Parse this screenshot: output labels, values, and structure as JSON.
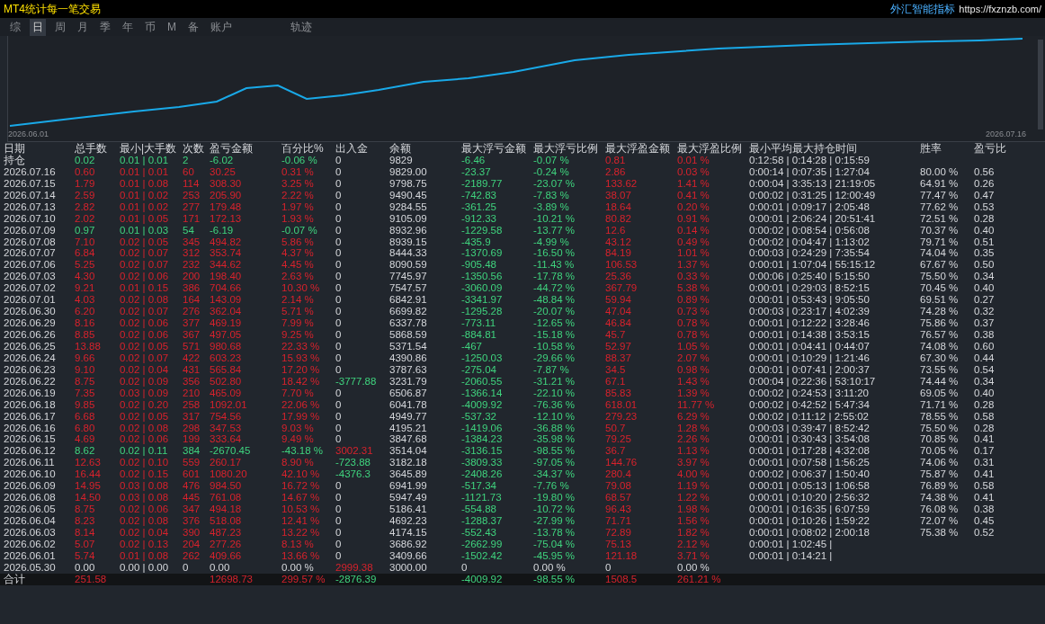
{
  "window": {
    "title": "MT4统计每一笔交易",
    "brand": "外汇智能指标",
    "link": "https://fxznzb.com/"
  },
  "tabs": [
    {
      "label": "综",
      "selected": false
    },
    {
      "label": "日",
      "selected": true
    },
    {
      "label": "周",
      "selected": false
    },
    {
      "label": "月",
      "selected": false
    },
    {
      "label": "季",
      "selected": false
    },
    {
      "label": "年",
      "selected": false
    },
    {
      "label": "币",
      "selected": false
    },
    {
      "label": "M",
      "selected": false
    },
    {
      "label": "备",
      "selected": false
    },
    {
      "label": "账户",
      "selected": false
    },
    {
      "label": "轨迹",
      "selected": false
    }
  ],
  "chart": {
    "start_label": "2026.06.01",
    "end_label": "2026.07.16"
  },
  "table": {
    "columns": [
      "日期",
      "总手数",
      "最小|大手数",
      "次数",
      "盈亏金额",
      "百分比%",
      "出入金",
      "余额",
      "最大浮亏金额",
      "最大浮亏比例",
      "最大浮盈金额",
      "最大浮盈比例",
      "最小平均最大持仓时间",
      "胜率",
      "盈亏比"
    ],
    "rows": [
      {
        "kind": "loss",
        "cells": [
          "持仓",
          "0.02",
          "0.01 | 0.01",
          "2",
          "-6.02",
          "-0.06 %",
          "0",
          "9829",
          "-6.46",
          "-0.07 %",
          "0.81",
          "0.01 %",
          "0:12:58 | 0:14:28 | 0:15:59"
        ]
      },
      {
        "kind": "gain",
        "cells": [
          "2026.07.16",
          "0.60",
          "0.01 | 0.01",
          "60",
          "30.25",
          "0.31 %",
          "0",
          "9829.00",
          "-23.37",
          "-0.24 %",
          "2.86",
          "0.03 %",
          "0:00:14 | 0:07:35 | 1:27:04",
          "80.00 %",
          "0.56"
        ]
      },
      {
        "kind": "gain",
        "cells": [
          "2026.07.15",
          "1.79",
          "0.01 | 0.08",
          "114",
          "308.30",
          "3.25 %",
          "0",
          "9798.75",
          "-2189.77",
          "-23.07 %",
          "133.62",
          "1.41 %",
          "0:00:04 | 3:35:13 | 21:19:05",
          "64.91 %",
          "0.26"
        ]
      },
      {
        "kind": "gain",
        "cells": [
          "2026.07.14",
          "2.59",
          "0.01 | 0.02",
          "253",
          "205.90",
          "2.22 %",
          "0",
          "9490.45",
          "-742.83",
          "-7.83 %",
          "38.07",
          "0.41 %",
          "0:00:02 | 0:31:25 | 12:00:49",
          "77.47 %",
          "0.47"
        ]
      },
      {
        "kind": "gain",
        "cells": [
          "2026.07.13",
          "2.82",
          "0.01 | 0.02",
          "277",
          "179.48",
          "1.97 %",
          "0",
          "9284.55",
          "-361.25",
          "-3.89 %",
          "18.64",
          "0.20 %",
          "0:00:01 | 0:09:17 | 2:05:48",
          "77.62 %",
          "0.53"
        ]
      },
      {
        "kind": "gain",
        "cells": [
          "2026.07.10",
          "2.02",
          "0.01 | 0.05",
          "171",
          "172.13",
          "1.93 %",
          "0",
          "9105.09",
          "-912.33",
          "-10.21 %",
          "80.82",
          "0.91 %",
          "0:00:01 | 2:06:24 | 20:51:41",
          "72.51 %",
          "0.28"
        ]
      },
      {
        "kind": "loss",
        "cells": [
          "2026.07.09",
          "0.97",
          "0.01 | 0.03",
          "54",
          "-6.19",
          "-0.07 %",
          "0",
          "8932.96",
          "-1229.58",
          "-13.77 %",
          "12.6",
          "0.14 %",
          "0:00:02 | 0:08:54 | 0:56:08",
          "70.37 %",
          "0.40"
        ]
      },
      {
        "kind": "gain",
        "cells": [
          "2026.07.08",
          "7.10",
          "0.02 | 0.05",
          "345",
          "494.82",
          "5.86 %",
          "0",
          "8939.15",
          "-435.9",
          "-4.99 %",
          "43.12",
          "0.49 %",
          "0:00:02 | 0:04:47 | 1:13:02",
          "79.71 %",
          "0.51"
        ]
      },
      {
        "kind": "gain",
        "cells": [
          "2026.07.07",
          "6.84",
          "0.02 | 0.07",
          "312",
          "353.74",
          "4.37 %",
          "0",
          "8444.33",
          "-1370.69",
          "-16.50 %",
          "84.19",
          "1.01 %",
          "0:00:03 | 0:24:29 | 7:35:54",
          "74.04 %",
          "0.35"
        ]
      },
      {
        "kind": "gain",
        "cells": [
          "2026.07.06",
          "5.25",
          "0.02 | 0.07",
          "232",
          "344.62",
          "4.45 %",
          "0",
          "8090.59",
          "-905.48",
          "-11.43 %",
          "106.53",
          "1.37 %",
          "0:00:01 | 1:07:04 | 55:15:12",
          "67.67 %",
          "0.50"
        ]
      },
      {
        "kind": "gain",
        "cells": [
          "2026.07.03",
          "4.30",
          "0.02 | 0.06",
          "200",
          "198.40",
          "2.63 %",
          "0",
          "7745.97",
          "-1350.56",
          "-17.78 %",
          "25.36",
          "0.33 %",
          "0:00:06 | 0:25:40 | 5:15:50",
          "75.50 %",
          "0.34"
        ]
      },
      {
        "kind": "gain",
        "cells": [
          "2026.07.02",
          "9.21",
          "0.01 | 0.15",
          "386",
          "704.66",
          "10.30 %",
          "0",
          "7547.57",
          "-3060.09",
          "-44.72 %",
          "367.79",
          "5.38 %",
          "0:00:01 | 0:29:03 | 8:52:15",
          "70.45 %",
          "0.40"
        ]
      },
      {
        "kind": "gain",
        "cells": [
          "2026.07.01",
          "4.03",
          "0.02 | 0.08",
          "164",
          "143.09",
          "2.14 %",
          "0",
          "6842.91",
          "-3341.97",
          "-48.84 %",
          "59.94",
          "0.89 %",
          "0:00:01 | 0:53:43 | 9:05:50",
          "69.51 %",
          "0.27"
        ]
      },
      {
        "kind": "gain",
        "cells": [
          "2026.06.30",
          "6.20",
          "0.02 | 0.07",
          "276",
          "362.04",
          "5.71 %",
          "0",
          "6699.82",
          "-1295.28",
          "-20.07 %",
          "47.04",
          "0.73 %",
          "0:00:03 | 0:23:17 | 4:02:39",
          "74.28 %",
          "0.32"
        ]
      },
      {
        "kind": "gain",
        "cells": [
          "2026.06.29",
          "8.16",
          "0.02 | 0.06",
          "377",
          "469.19",
          "7.99 %",
          "0",
          "6337.78",
          "-773.11",
          "-12.65 %",
          "46.84",
          "0.78 %",
          "0:00:01 | 0:12:22 | 3:28:46",
          "75.86 %",
          "0.37"
        ]
      },
      {
        "kind": "gain",
        "cells": [
          "2026.06.26",
          "8.85",
          "0.02 | 0.06",
          "367",
          "497.05",
          "9.25 %",
          "0",
          "5868.59",
          "-884.81",
          "-15.18 %",
          "45.7",
          "0.78 %",
          "0:00:01 | 0:14:38 | 3:53:15",
          "76.57 %",
          "0.38"
        ]
      },
      {
        "kind": "gain",
        "cells": [
          "2026.06.25",
          "13.88",
          "0.02 | 0.05",
          "571",
          "980.68",
          "22.33 %",
          "0",
          "5371.54",
          "-467",
          "-10.58 %",
          "52.97",
          "1.05 %",
          "0:00:01 | 0:04:41 | 0:44:07",
          "74.08 %",
          "0.60"
        ]
      },
      {
        "kind": "gain",
        "cells": [
          "2026.06.24",
          "9.66",
          "0.02 | 0.07",
          "422",
          "603.23",
          "15.93 %",
          "0",
          "4390.86",
          "-1250.03",
          "-29.66 %",
          "88.37",
          "2.07 %",
          "0:00:01 | 0:10:29 | 1:21:46",
          "67.30 %",
          "0.44"
        ]
      },
      {
        "kind": "gain",
        "cells": [
          "2026.06.23",
          "9.10",
          "0.02 | 0.04",
          "431",
          "565.84",
          "17.20 %",
          "0",
          "3787.63",
          "-275.04",
          "-7.87 %",
          "34.5",
          "0.98 %",
          "0:00:01 | 0:07:41 | 2:00:37",
          "73.55 %",
          "0.54"
        ]
      },
      {
        "kind": "gain",
        "cells": [
          "2026.06.22",
          "8.75",
          "0.02 | 0.09",
          "356",
          "502.80",
          "18.42 %",
          {
            "text": "-3777.88",
            "kind": "out"
          },
          "3231.79",
          "-2060.55",
          "-31.21 %",
          "67.1",
          "1.43 %",
          "0:00:04 | 0:22:36 | 53:10:17",
          "74.44 %",
          "0.34"
        ]
      },
      {
        "kind": "gain",
        "cells": [
          "2026.06.19",
          "7.35",
          "0.03 | 0.09",
          "210",
          "465.09",
          "7.70 %",
          "0",
          "6506.87",
          "-1366.14",
          "-22.10 %",
          "85.83",
          "1.39 %",
          "0:00:02 | 0:24:53 | 3:11:20",
          "69.05 %",
          "0.40"
        ]
      },
      {
        "kind": "gain",
        "cells": [
          "2026.06.18",
          "9.85",
          "0.02 | 0.20",
          "258",
          "1092.01",
          "22.06 %",
          "0",
          "6041.78",
          "-4009.92",
          "-76.36 %",
          "618.01",
          "11.77 %",
          "0:00:02 | 0:42:52 | 5:47:34",
          "71.71 %",
          "0.28"
        ]
      },
      {
        "kind": "gain",
        "cells": [
          "2026.06.17",
          "6.68",
          "0.02 | 0.05",
          "317",
          "754.56",
          "17.99 %",
          "0",
          "4949.77",
          "-537.32",
          "-12.10 %",
          "279.23",
          "6.29 %",
          "0:00:02 | 0:11:12 | 2:55:02",
          "78.55 %",
          "0.58"
        ]
      },
      {
        "kind": "gain",
        "cells": [
          "2026.06.16",
          "6.80",
          "0.02 | 0.08",
          "298",
          "347.53",
          "9.03 %",
          "0",
          "4195.21",
          "-1419.06",
          "-36.88 %",
          "50.7",
          "1.28 %",
          "0:00:03 | 0:39:47 | 8:52:42",
          "75.50 %",
          "0.28"
        ]
      },
      {
        "kind": "gain",
        "cells": [
          "2026.06.15",
          "4.69",
          "0.02 | 0.06",
          "199",
          "333.64",
          "9.49 %",
          "0",
          "3847.68",
          "-1384.23",
          "-35.98 %",
          "79.25",
          "2.26 %",
          "0:00:01 | 0:30:43 | 3:54:08",
          "70.85 %",
          "0.41"
        ]
      },
      {
        "kind": "loss",
        "cells": [
          "2026.06.12",
          "8.62",
          "0.02 | 0.11",
          "384",
          "-2670.45",
          "-43.18 %",
          {
            "text": "3002.31",
            "kind": "in"
          },
          "3514.04",
          "-3136.15",
          "-98.55 %",
          "36.7",
          "1.13 %",
          "0:00:01 | 0:17:28 | 4:32:08",
          "70.05 %",
          "0.17"
        ]
      },
      {
        "kind": "gain",
        "cells": [
          "2026.06.11",
          "12.63",
          "0.02 | 0.10",
          "559",
          "260.17",
          "8.90 %",
          {
            "text": "-723.88",
            "kind": "out"
          },
          "3182.18",
          "-3809.33",
          "-97.05 %",
          "144.76",
          "3.97 %",
          "0:00:01 | 0:07:58 | 1:56:25",
          "74.06 %",
          "0.31"
        ]
      },
      {
        "kind": "gain",
        "cells": [
          "2026.06.10",
          "16.44",
          "0.02 | 0.15",
          "601",
          "1080.20",
          "42.10 %",
          {
            "text": "-4376.3",
            "kind": "out"
          },
          "3645.89",
          "-2408.26",
          "-34.37 %",
          "280.4",
          "4.00 %",
          "0:00:02 | 0:06:37 | 1:50:40",
          "75.87 %",
          "0.41"
        ]
      },
      {
        "kind": "gain",
        "cells": [
          "2026.06.09",
          "14.95",
          "0.03 | 0.08",
          "476",
          "984.50",
          "16.72 %",
          "0",
          "6941.99",
          "-517.34",
          "-7.76 %",
          "79.08",
          "1.19 %",
          "0:00:01 | 0:05:13 | 1:06:58",
          "76.89 %",
          "0.58"
        ]
      },
      {
        "kind": "gain",
        "cells": [
          "2026.06.08",
          "14.50",
          "0.03 | 0.08",
          "445",
          "761.08",
          "14.67 %",
          "0",
          "5947.49",
          "-1121.73",
          "-19.80 %",
          "68.57",
          "1.22 %",
          "0:00:01 | 0:10:20 | 2:56:32",
          "74.38 %",
          "0.41"
        ]
      },
      {
        "kind": "gain",
        "cells": [
          "2026.06.05",
          "8.75",
          "0.02 | 0.06",
          "347",
          "494.18",
          "10.53 %",
          "0",
          "5186.41",
          "-554.88",
          "-10.72 %",
          "96.43",
          "1.98 %",
          "0:00:01 | 0:16:35 | 6:07:59",
          "76.08 %",
          "0.38"
        ]
      },
      {
        "kind": "gain",
        "cells": [
          "2026.06.04",
          "8.23",
          "0.02 | 0.08",
          "376",
          "518.08",
          "12.41 %",
          "0",
          "4692.23",
          "-1288.37",
          "-27.99 %",
          "71.71",
          "1.56 %",
          "0:00:01 | 0:10:26 | 1:59:22",
          "72.07 %",
          "0.45"
        ]
      },
      {
        "kind": "gain",
        "cells": [
          "2026.06.03",
          "8.14",
          "0.02 | 0.04",
          "390",
          "487.23",
          "13.22 %",
          "0",
          "4174.15",
          "-552.43",
          "-13.78 %",
          "72.89",
          "1.82 %",
          "0:00:01 | 0:08:02 | 2:00:18",
          "75.38 %",
          "0.52"
        ]
      },
      {
        "kind": "gain",
        "cells": [
          "2026.06.02",
          "5.07",
          "0.02 | 0.13",
          "204",
          "277.26",
          "8.13 %",
          "0",
          "3686.92",
          "-2662.99",
          "-75.04 %",
          "75.13",
          "2.12 %",
          "0:00:01 | 1:02:45 |"
        ]
      },
      {
        "kind": "gain",
        "cells": [
          "2026.06.01",
          "5.74",
          "0.01 | 0.08",
          "262",
          "409.66",
          "13.66 %",
          "0",
          "3409.66",
          "-1502.42",
          "-45.95 %",
          "121.18",
          "3.71 %",
          "0:00:01 | 0:14:21 |"
        ]
      },
      {
        "kind": "flat",
        "cells": [
          "2026.05.30",
          "0.00",
          "0.00 | 0.00",
          "0",
          "0.00",
          "0.00 %",
          {
            "text": "2999.38",
            "kind": "in"
          },
          "3000.00",
          "0",
          "0.00 %",
          "0",
          "0.00 %"
        ]
      }
    ],
    "totals": {
      "label": "合计",
      "total_lots": {
        "text": "251.58",
        "kind": "gain"
      },
      "pnl": {
        "text": "12698.73",
        "kind": "gain"
      },
      "percent": {
        "text": "299.57 %",
        "kind": "gain"
      },
      "flow": {
        "text": "-2876.39",
        "kind": "loss"
      },
      "max_float_loss": {
        "text": "-4009.92",
        "kind": "loss"
      },
      "max_float_loss_ratio": {
        "text": "-98.55 %",
        "kind": "loss"
      },
      "max_float_profit": {
        "text": "1508.5",
        "kind": "gain"
      },
      "max_float_profit_ratio": {
        "text": "261.21 %",
        "kind": "gain"
      }
    }
  }
}
